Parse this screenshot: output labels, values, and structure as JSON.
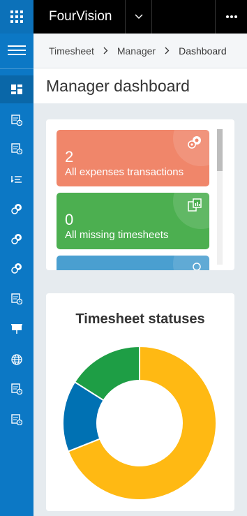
{
  "app": {
    "name": "FourVision"
  },
  "breadcrumb": {
    "items": [
      "Timesheet",
      "Manager",
      "Dashboard"
    ]
  },
  "page": {
    "title": "Manager dashboard"
  },
  "tiles": [
    {
      "count": "2",
      "label": "All expenses transactions",
      "color": "#f0866a",
      "icon": "expense-coins-icon"
    },
    {
      "count": "0",
      "label": "All missing timesheets",
      "color": "#4caf50",
      "icon": "timesheet-chart-icon"
    },
    {
      "count": "",
      "label": "",
      "color": "#4a9fd0",
      "icon": "tile-icon"
    }
  ],
  "rail": {
    "items": [
      "dashboard-icon",
      "timesheet-clock-icon",
      "timesheet-clock-icon",
      "sort-lines-icon",
      "coins-icon",
      "coins-icon",
      "coins-icon",
      "timesheet-clock-icon",
      "presentation-icon",
      "globe-icon",
      "timesheet-clock-icon",
      "timesheet-clock-icon"
    ]
  },
  "chart_data": {
    "type": "pie",
    "title": "Timesheet statuses",
    "donut": true,
    "categories": [
      "",
      "",
      ""
    ],
    "values": [
      69,
      15,
      16
    ],
    "colors": [
      "#ffb913",
      "#0071b3",
      "#1e9e45"
    ]
  }
}
